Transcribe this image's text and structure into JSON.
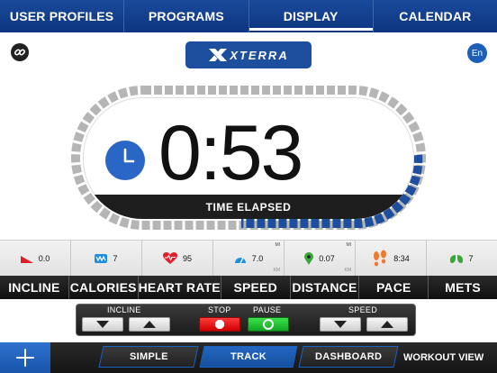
{
  "nav": {
    "tabs": [
      {
        "label": "USER PROFILES"
      },
      {
        "label": "PROGRAMS"
      },
      {
        "label": "DISPLAY"
      },
      {
        "label": "CALENDAR"
      }
    ]
  },
  "header": {
    "brand": "XTERRA",
    "language": "En"
  },
  "timer": {
    "time": "0:53",
    "caption": "TIME ELAPSED"
  },
  "metrics": [
    {
      "label": "INCLINE",
      "value": "0.0",
      "icon": "incline-icon"
    },
    {
      "label": "CALORIES",
      "value": "7",
      "icon": "calories-icon"
    },
    {
      "label": "HEART RATE",
      "value": "95",
      "icon": "heart-icon"
    },
    {
      "label": "SPEED",
      "value": "7.0",
      "unit_top": "MI",
      "unit_bottom": "KM",
      "icon": "speedometer-icon"
    },
    {
      "label": "DISTANCE",
      "value": "0.07",
      "unit_top": "MI",
      "unit_bottom": "KM",
      "icon": "location-pin-icon"
    },
    {
      "label": "PACE",
      "value": "8:34",
      "icon": "footprints-icon"
    },
    {
      "label": "METS",
      "value": "7",
      "icon": "lungs-icon"
    }
  ],
  "controls": {
    "incline_label": "INCLINE",
    "stop_label": "STOP",
    "pause_label": "PAUSE",
    "speed_label": "SPEED"
  },
  "bottom": {
    "simple_label": "SIMPLE",
    "track_label": "TRACK",
    "dashboard_label": "DASHBOARD",
    "workout_view_label": "WORKOUT VIEW"
  },
  "colors": {
    "accent_blue": "#1a4a9b",
    "track_progress": "#1d4f9e",
    "track_segment": "#b5b5b5"
  }
}
